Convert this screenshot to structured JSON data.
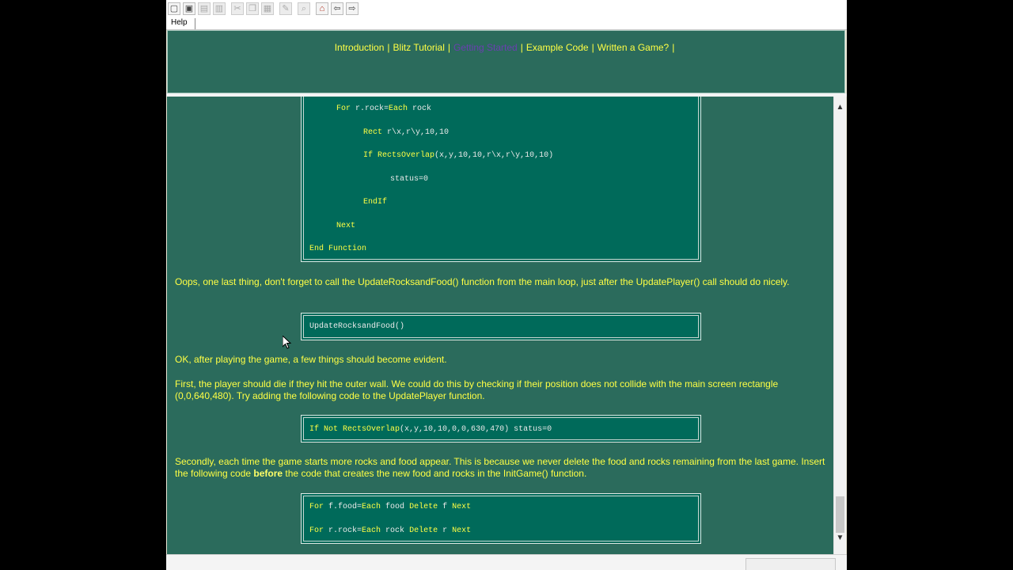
{
  "toolbar": {
    "buttons": [
      {
        "name": "new-icon",
        "glyph": "▢"
      },
      {
        "name": "open-folder-icon",
        "glyph": "▣"
      },
      {
        "name": "save-icon",
        "glyph": "▤"
      },
      {
        "name": "print-icon",
        "glyph": "▥"
      },
      {
        "name": "cut-icon",
        "glyph": "✂"
      },
      {
        "name": "copy-icon",
        "glyph": "❐"
      },
      {
        "name": "paste-icon",
        "glyph": "▦"
      },
      {
        "name": "edit-icon",
        "glyph": "✎"
      },
      {
        "name": "find-icon",
        "glyph": "⌕"
      },
      {
        "name": "home-icon",
        "glyph": "⌂"
      },
      {
        "name": "back-icon",
        "glyph": "⇦"
      },
      {
        "name": "forward-icon",
        "glyph": "⇨"
      }
    ]
  },
  "menu": {
    "help": "Help"
  },
  "nav": {
    "introduction": "Introduction",
    "blitz_tutorial": "Blitz Tutorial",
    "getting_started": "Getting Started",
    "example_code": "Example Code",
    "written_a_game": "Written a Game?",
    "separator": "|"
  },
  "code_block_1": {
    "lines": [
      {
        "kw": "For",
        "rest": " r.rock=",
        "kw2": "Each",
        "rest2": " rock"
      },
      {
        "kw": "Rect",
        "rest": " r\\x,r\\y,10,10"
      },
      {
        "kw": "If",
        "rest": " ",
        "kw2": "RectsOverlap",
        "rest2": "(x,y,10,10,r\\x,r\\y,10,10)"
      },
      {
        "kw": "",
        "rest": "status=0"
      },
      {
        "kw": "EndIf",
        "rest": ""
      },
      {
        "kw": "Next",
        "rest": ""
      },
      {
        "kw": "End Function",
        "rest": ""
      }
    ]
  },
  "para_1": "Oops, one last thing, don't forget to call the UpdateRocksandFood() function from the main loop, just after the UpdatePlayer() call should do nicely.",
  "code_block_2": "UpdateRocksandFood()",
  "para_2": "OK, after playing the game, a few things should become evident.",
  "para_3": "First, the player should die if they hit the outer wall. We could do this by checking if their position does not collide with the main screen rectangle (0,0,640,480). Try adding the following code to the UpdatePlayer function.",
  "code_block_3": {
    "kw1": "If Not",
    "kw2": "RectsOverlap",
    "rest": "(x,y,10,10,0,0,630,470) status=0"
  },
  "para_4": {
    "before": "Secondly, each time the game starts more rocks and food appear. This is because we never delete the food and rocks remaining from the last game. Insert the following code ",
    "bold": "before",
    "after": " the code that creates the new food and rocks in the InitGame() function."
  },
  "code_block_4": {
    "line1": {
      "a": "For",
      "b": " f.food=",
      "c": "Each",
      "d": " food ",
      "e": "Delete",
      "f": " f ",
      "g": "Next"
    },
    "line2": {
      "a": "For",
      "b": " r.rock=",
      "c": "Each",
      "d": " rock ",
      "e": "Delete",
      "f": " r ",
      "g": "Next"
    }
  },
  "scrollbar": {
    "up": "▲",
    "down": "▼"
  },
  "colors": {
    "page_bg": "#2b6b5c",
    "code_bg": "#006a5a",
    "text": "#ffff44",
    "visited": "#6a3fb0"
  }
}
